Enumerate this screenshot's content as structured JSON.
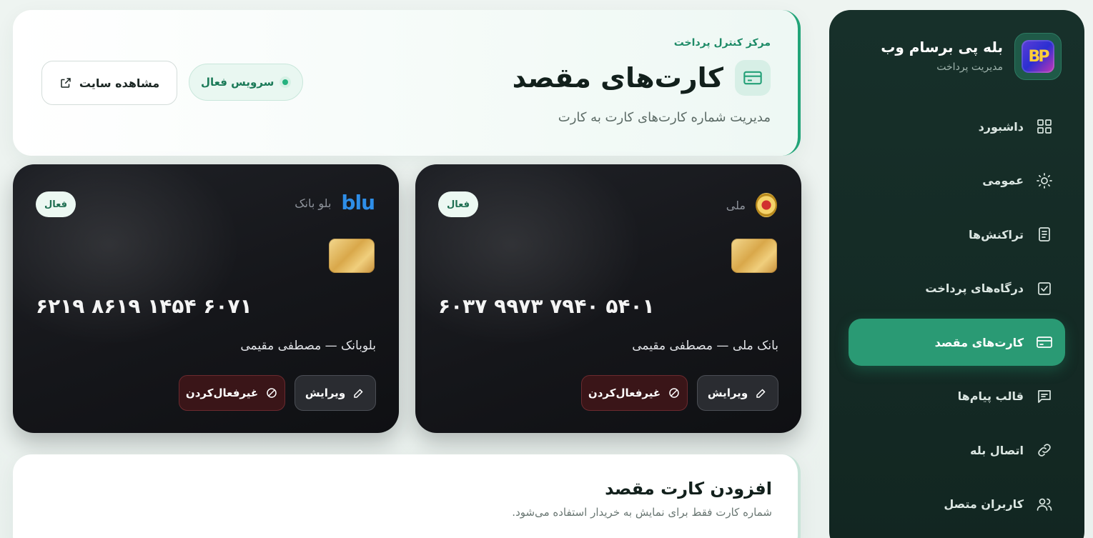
{
  "brand": {
    "title": "بله پی برسام وب",
    "subtitle": "مدیریت پرداخت",
    "logo_text": "BP"
  },
  "nav": [
    {
      "label": "داشبورد",
      "icon": "grid-icon",
      "active": false
    },
    {
      "label": "عمومی",
      "icon": "sun-icon",
      "active": false
    },
    {
      "label": "تراکنش‌ها",
      "icon": "document-icon",
      "active": false
    },
    {
      "label": "درگاه‌های پرداخت",
      "icon": "checkbox-icon",
      "active": false
    },
    {
      "label": "کارت‌های مقصد",
      "icon": "credit-card-icon",
      "active": true
    },
    {
      "label": "قالب پیام‌ها",
      "icon": "message-icon",
      "active": false
    },
    {
      "label": "اتصال بله",
      "icon": "link-icon",
      "active": false
    },
    {
      "label": "کاربران متصل",
      "icon": "users-icon",
      "active": false
    }
  ],
  "header": {
    "breadcrumb": "مرکز کنترل پرداخت",
    "title": "کارت‌های مقصد",
    "subtitle": "مدیریت شماره کارت‌های کارت به کارت",
    "status_label": "سرویس فعال",
    "view_site_label": "مشاهده سایت"
  },
  "cards": [
    {
      "bank_short": "ملی",
      "number": "۶۰۳۷ ۹۹۷۳ ۷۹۴۰ ۵۴۰۱",
      "holder": "بانک ملی — مصطفی مقیمی",
      "badge": "فعال",
      "edit_label": "ویرایش",
      "disable_label": "غیرفعال‌کردن"
    },
    {
      "bank_short": "بلو بانک",
      "bank_logo_text": "blu",
      "number": "۶۲۱۹ ۸۶۱۹ ۱۴۵۴ ۶۰۷۱",
      "holder": "بلوبانک — مصطفی مقیمی",
      "badge": "فعال",
      "edit_label": "ویرایش",
      "disable_label": "غیرفعال‌کردن"
    }
  ],
  "add_card": {
    "title": "افزودن کارت مقصد",
    "subtitle": "شماره کارت فقط برای نمایش به خریدار استفاده می‌شود."
  },
  "colors": {
    "accent": "#2a9a74",
    "sidebar": "#17302a",
    "danger_bg": "#3a1518"
  }
}
